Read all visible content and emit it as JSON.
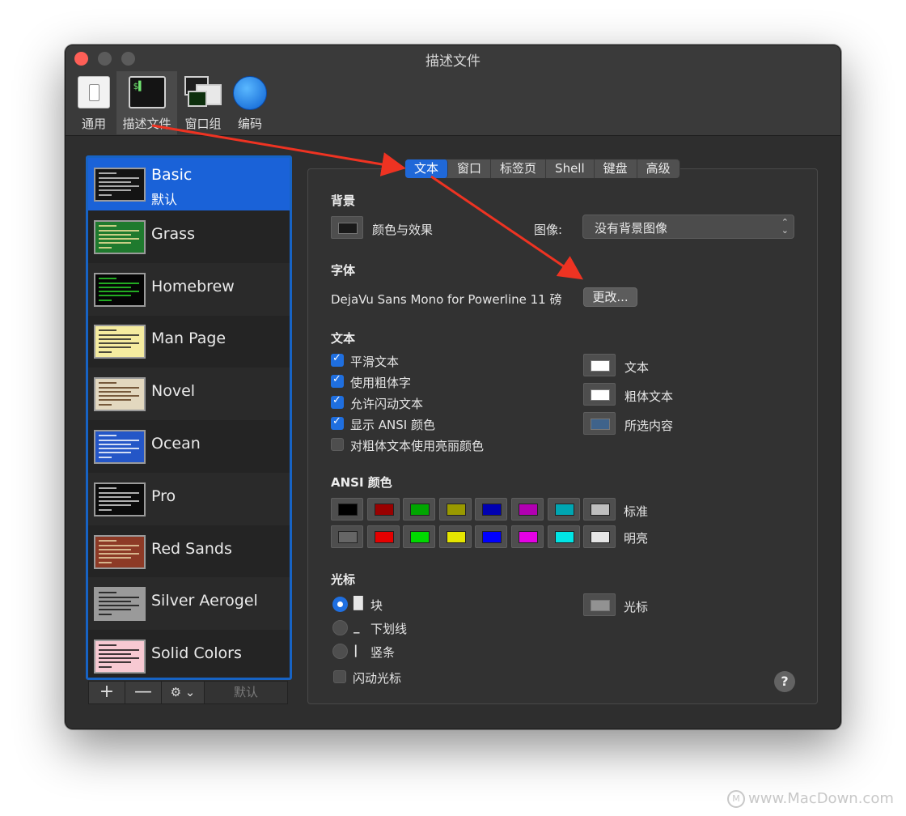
{
  "window": {
    "title": "描述文件"
  },
  "toolbar": {
    "items": [
      {
        "label": "通用",
        "icon": "switch-icon"
      },
      {
        "label": "描述文件",
        "icon": "terminal-icon"
      },
      {
        "label": "窗口组",
        "icon": "window-group-icon"
      },
      {
        "label": "编码",
        "icon": "globe-icon"
      }
    ],
    "selected": "描述文件"
  },
  "profiles": [
    {
      "name": "Basic",
      "default_label": "默认",
      "bg": "#141414",
      "fg": "#cfcfcf"
    },
    {
      "name": "Grass",
      "bg": "#1f7a2e",
      "fg": "#f2e39a"
    },
    {
      "name": "Homebrew",
      "bg": "#050505",
      "fg": "#29d429"
    },
    {
      "name": "Man Page",
      "bg": "#f5eca0",
      "fg": "#222222"
    },
    {
      "name": "Novel",
      "bg": "#e3d8bf",
      "fg": "#5a3a1a"
    },
    {
      "name": "Ocean",
      "bg": "#2456c7",
      "fg": "#ffffff"
    },
    {
      "name": "Pro",
      "bg": "#0c0c0c",
      "fg": "#d8d8d8"
    },
    {
      "name": "Red Sands",
      "bg": "#8d3a26",
      "fg": "#e8d3a6"
    },
    {
      "name": "Silver Aerogel",
      "bg": "#9a9a9a",
      "fg": "#111111"
    },
    {
      "name": "Solid Colors",
      "bg": "#f7c9d2",
      "fg": "#111111"
    }
  ],
  "sidebar_controls": {
    "add": "+",
    "remove": "—",
    "gear": "⚙ ⌄",
    "default": "默认"
  },
  "tabs": [
    "文本",
    "窗口",
    "标签页",
    "Shell",
    "键盘",
    "高级"
  ],
  "active_tab": "文本",
  "background": {
    "title": "背景",
    "color_effects_label": "颜色与效果",
    "color": "#1a1a1a",
    "image_label": "图像:",
    "image_value": "没有背景图像"
  },
  "font": {
    "title": "字体",
    "value": "DejaVu Sans Mono for Powerline 11 磅",
    "change_button": "更改..."
  },
  "text": {
    "title": "文本",
    "options": [
      {
        "label": "平滑文本",
        "checked": true
      },
      {
        "label": "使用粗体字",
        "checked": true
      },
      {
        "label": "允许闪动文本",
        "checked": true
      },
      {
        "label": "显示 ANSI 颜色",
        "checked": true
      },
      {
        "label": "对粗体文本使用亮丽颜色",
        "checked": false
      }
    ],
    "colors": [
      {
        "label": "文本",
        "color": "#ffffff"
      },
      {
        "label": "粗体文本",
        "color": "#ffffff"
      },
      {
        "label": "所选内容",
        "color": "#3f638b"
      }
    ]
  },
  "ansi": {
    "title": "ANSI 颜色",
    "normal_label": "标准",
    "bright_label": "明亮",
    "normal": [
      "#000000",
      "#990000",
      "#00a600",
      "#999900",
      "#0000b2",
      "#b200b2",
      "#00a6b2",
      "#bfbfbf"
    ],
    "bright": [
      "#666666",
      "#e50000",
      "#00d900",
      "#e5e500",
      "#0000ff",
      "#e500e5",
      "#00e5e5",
      "#e5e5e5"
    ]
  },
  "cursor": {
    "title": "光标",
    "options": [
      {
        "glyph": "█",
        "label": "块",
        "selected": true
      },
      {
        "glyph": "_",
        "label": "下划线",
        "selected": false
      },
      {
        "glyph": "|",
        "label": "竖条",
        "selected": false
      }
    ],
    "blink_label": "闪动光标",
    "blink_checked": false,
    "color_label": "光标",
    "color": "#929292"
  },
  "help": "?",
  "watermark": "www.MacDown.com",
  "annotation_color": "#ee3322"
}
